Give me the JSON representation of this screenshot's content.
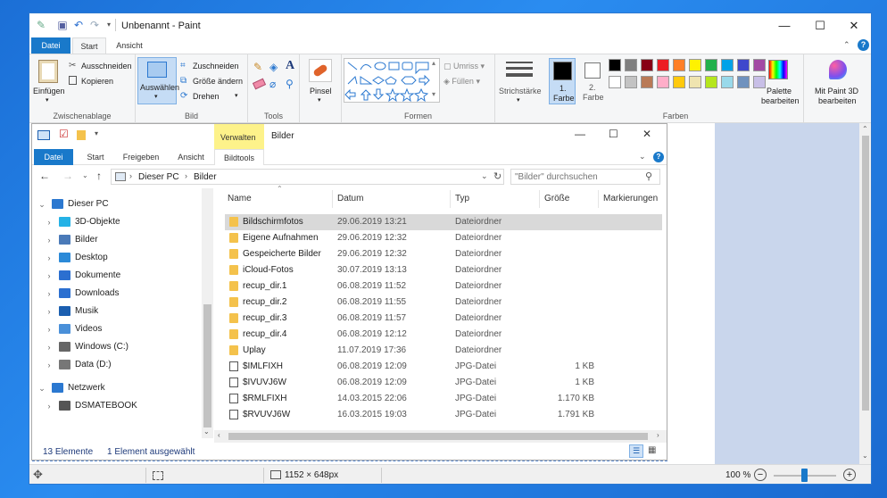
{
  "paint": {
    "title": "Unbenannt - Paint",
    "tabs": [
      "Datei",
      "Start",
      "Ansicht"
    ],
    "clipboard": {
      "paste": "Einfügen",
      "cut": "Ausschneiden",
      "copy": "Kopieren",
      "label": "Zwischenablage"
    },
    "image": {
      "select": "Auswählen",
      "crop": "Zuschneiden",
      "resize": "Größe ändern",
      "rotate": "Drehen",
      "label": "Bild"
    },
    "tools": {
      "label": "Tools",
      "brush": "Pinsel"
    },
    "shapes": {
      "outline": "Umriss",
      "fill": "Füllen",
      "label": "Formen"
    },
    "stroke": "Strichstärke",
    "color1": "1.\nFarbe",
    "color1_a": "1.",
    "color1_b": "Farbe",
    "color2_a": "2.",
    "color2_b": "Farbe",
    "colors_label": "Farben",
    "edit_palette_a": "Palette",
    "edit_palette_b": "bearbeiten",
    "paint3d_a": "Mit Paint 3D",
    "paint3d_b": "bearbeiten",
    "palette": [
      "#000000",
      "#7f7f7f",
      "#880015",
      "#ed1c24",
      "#ff7f27",
      "#fff200",
      "#22b14c",
      "#00a2e8",
      "#3f48cc",
      "#a349a4",
      "#ffffff",
      "#c3c3c3",
      "#b97a57",
      "#ffaec9",
      "#ffc90e",
      "#efe4b0",
      "#b5e61d",
      "#99d9ea",
      "#7092be",
      "#c8bfe7"
    ],
    "status": {
      "size": "1152 × 648px",
      "zoom": "100 %"
    }
  },
  "explorer": {
    "context_tab": "Verwalten",
    "title": "Bilder",
    "tabs": [
      "Datei",
      "Start",
      "Freigeben",
      "Ansicht",
      "Bildtools"
    ],
    "path": [
      "Dieser PC",
      "Bilder"
    ],
    "search_placeholder": "\"Bilder\" durchsuchen",
    "columns": [
      "Name",
      "Datum",
      "Typ",
      "Größe",
      "Markierungen"
    ],
    "tree": [
      {
        "label": "Dieser PC",
        "level": 0,
        "arrow": "⌄"
      },
      {
        "label": "3D-Objekte",
        "level": 1,
        "arrow": "›"
      },
      {
        "label": "Bilder",
        "level": 1,
        "arrow": "›"
      },
      {
        "label": "Desktop",
        "level": 1,
        "arrow": "›"
      },
      {
        "label": "Dokumente",
        "level": 1,
        "arrow": "›"
      },
      {
        "label": "Downloads",
        "level": 1,
        "arrow": "›"
      },
      {
        "label": "Musik",
        "level": 1,
        "arrow": "›"
      },
      {
        "label": "Videos",
        "level": 1,
        "arrow": "›"
      },
      {
        "label": "Windows (C:)",
        "level": 1,
        "arrow": "›"
      },
      {
        "label": "Data (D:)",
        "level": 1,
        "arrow": "›"
      },
      {
        "label": "Netzwerk",
        "level": 0,
        "arrow": "⌄"
      },
      {
        "label": "DSMATEBOOK",
        "level": 1,
        "arrow": "›"
      }
    ],
    "files": [
      {
        "name": "Bildschirmfotos",
        "date": "29.06.2019 13:21",
        "type": "Dateiordner",
        "size": "",
        "kind": "folder"
      },
      {
        "name": "Eigene Aufnahmen",
        "date": "29.06.2019 12:32",
        "type": "Dateiordner",
        "size": "",
        "kind": "folder"
      },
      {
        "name": "Gespeicherte Bilder",
        "date": "29.06.2019 12:32",
        "type": "Dateiordner",
        "size": "",
        "kind": "folder"
      },
      {
        "name": "iCloud-Fotos",
        "date": "30.07.2019 13:13",
        "type": "Dateiordner",
        "size": "",
        "kind": "folder"
      },
      {
        "name": "recup_dir.1",
        "date": "06.08.2019 11:52",
        "type": "Dateiordner",
        "size": "",
        "kind": "folder"
      },
      {
        "name": "recup_dir.2",
        "date": "06.08.2019 11:55",
        "type": "Dateiordner",
        "size": "",
        "kind": "folder"
      },
      {
        "name": "recup_dir.3",
        "date": "06.08.2019 11:57",
        "type": "Dateiordner",
        "size": "",
        "kind": "folder"
      },
      {
        "name": "recup_dir.4",
        "date": "06.08.2019 12:12",
        "type": "Dateiordner",
        "size": "",
        "kind": "folder"
      },
      {
        "name": "Uplay",
        "date": "11.07.2019 17:36",
        "type": "Dateiordner",
        "size": "",
        "kind": "folder"
      },
      {
        "name": "$IMLFIXH",
        "date": "06.08.2019 12:09",
        "type": "JPG-Datei",
        "size": "1 KB",
        "kind": "file"
      },
      {
        "name": "$IVUVJ6W",
        "date": "06.08.2019 12:09",
        "type": "JPG-Datei",
        "size": "1 KB",
        "kind": "file"
      },
      {
        "name": "$RMLFIXH",
        "date": "14.03.2015 22:06",
        "type": "JPG-Datei",
        "size": "1.170 KB",
        "kind": "file"
      },
      {
        "name": "$RVUVJ6W",
        "date": "16.03.2015 19:03",
        "type": "JPG-Datei",
        "size": "1.791 KB",
        "kind": "file"
      }
    ],
    "status": {
      "count": "13 Elemente",
      "selected": "1 Element ausgewählt"
    }
  }
}
